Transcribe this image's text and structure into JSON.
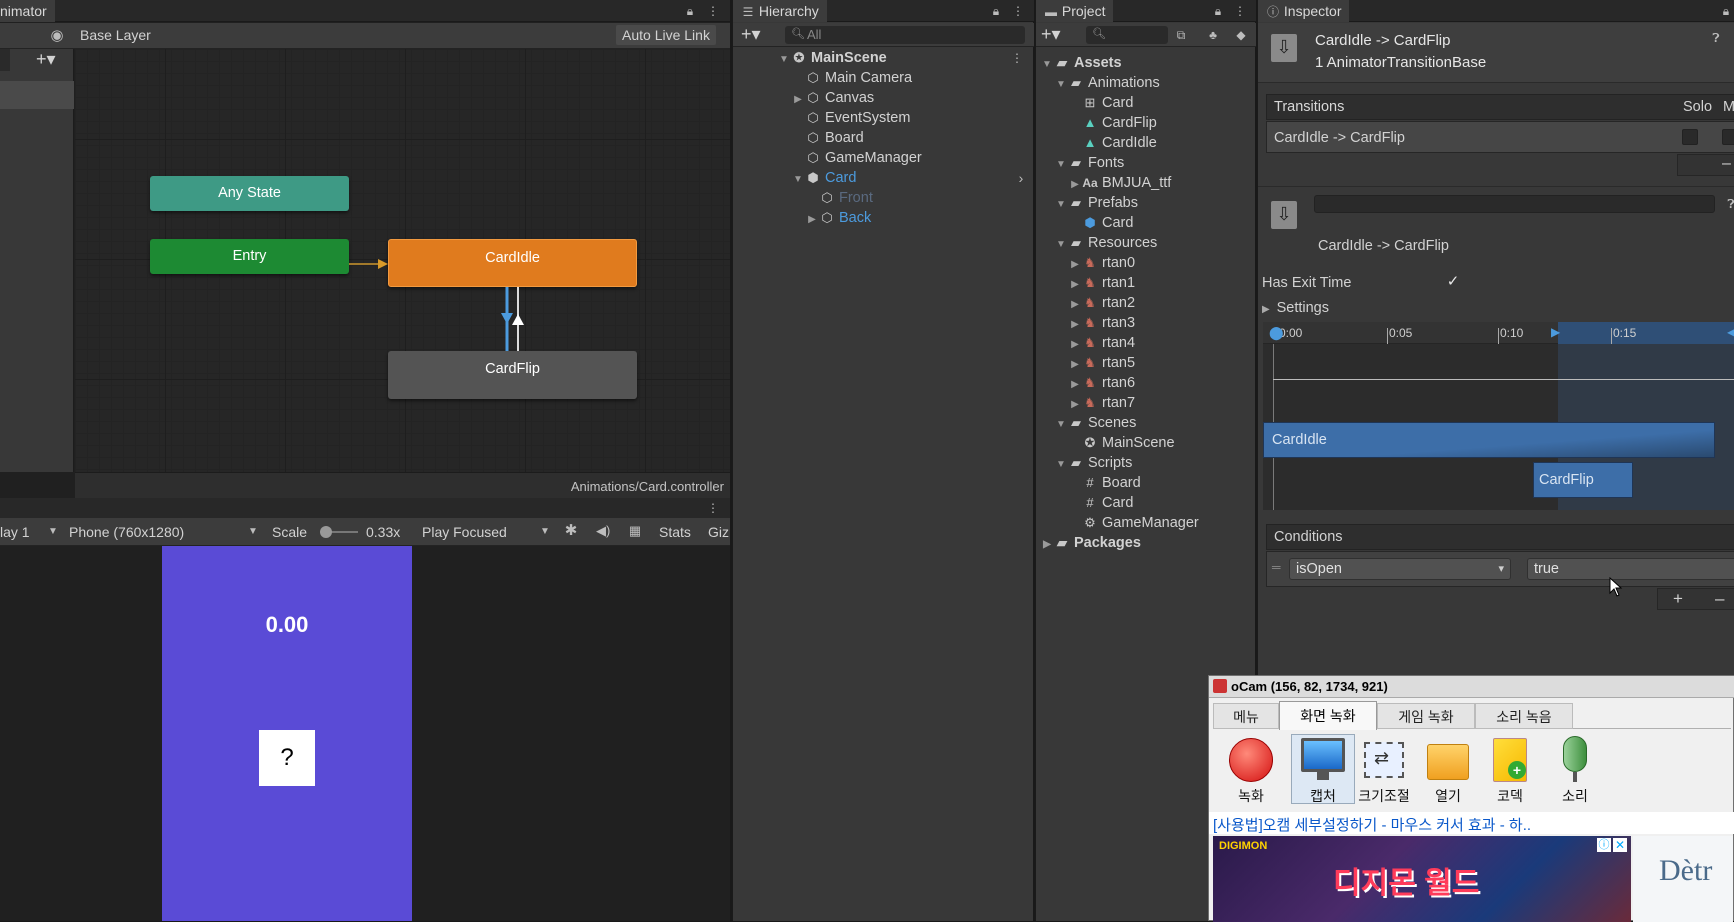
{
  "animator": {
    "tab": "nimator",
    "layer": "Base Layer",
    "auto_live_link": "Auto Live Link",
    "path": "Animations/Card.controller",
    "nodes": {
      "any_state": "Any State",
      "entry": "Entry",
      "card_idle": "CardIdle",
      "card_flip": "CardFlip"
    }
  },
  "game": {
    "display": "lay 1",
    "resolution": "Phone (760x1280)",
    "scale_label": "Scale",
    "scale_value": "0.33x",
    "play_mode": "Play Focused",
    "stats": "Stats",
    "gizmos": "Giz",
    "timer": "0.00",
    "card_text": "?"
  },
  "hierarchy": {
    "tab": "Hierarchy",
    "search_placeholder": "All",
    "items": [
      {
        "label": "MainScene"
      },
      {
        "label": "Main Camera"
      },
      {
        "label": "Canvas"
      },
      {
        "label": "EventSystem"
      },
      {
        "label": "Board"
      },
      {
        "label": "GameManager"
      },
      {
        "label": "Card"
      },
      {
        "label": "Front"
      },
      {
        "label": "Back"
      }
    ]
  },
  "project": {
    "tab": "Project",
    "items": [
      {
        "label": "Assets"
      },
      {
        "label": "Animations"
      },
      {
        "label": "Card"
      },
      {
        "label": "CardFlip"
      },
      {
        "label": "CardIdle"
      },
      {
        "label": "Fonts"
      },
      {
        "label": "BMJUA_ttf"
      },
      {
        "label": "Prefabs"
      },
      {
        "label": "Card"
      },
      {
        "label": "Resources"
      },
      {
        "label": "rtan0"
      },
      {
        "label": "rtan1"
      },
      {
        "label": "rtan2"
      },
      {
        "label": "rtan3"
      },
      {
        "label": "rtan4"
      },
      {
        "label": "rtan5"
      },
      {
        "label": "rtan6"
      },
      {
        "label": "rtan7"
      },
      {
        "label": "Scenes"
      },
      {
        "label": "MainScene"
      },
      {
        "label": "Scripts"
      },
      {
        "label": "Board"
      },
      {
        "label": "Card"
      },
      {
        "label": "GameManager"
      },
      {
        "label": "Packages"
      }
    ]
  },
  "inspector": {
    "tab": "Inspector",
    "title": "CardIdle -> CardFlip",
    "subtitle": "1 AnimatorTransitionBase",
    "transitions_header": "Transitions",
    "solo": "Solo",
    "mute": "Mu",
    "transition_row": "CardIdle -> CardFlip",
    "transition_name": "CardIdle -> CardFlip",
    "has_exit_time": "Has Exit Time",
    "settings": "Settings",
    "timeline": {
      "ticks": [
        "0:00",
        "0:05",
        "0:10",
        "0:15"
      ],
      "state_a": "CardIdle",
      "state_b": "CardFlip"
    },
    "conditions": "Conditions",
    "condition": {
      "param": "isOpen",
      "value": "true"
    }
  },
  "ocam": {
    "title": "oCam (156, 82, 1734, 921)",
    "tabs": [
      "메뉴",
      "화면 녹화",
      "게임 녹화",
      "소리 녹음"
    ],
    "buttons": [
      "녹화",
      "캡처",
      "크기조절",
      "열기",
      "코덱",
      "소리"
    ],
    "link": "[사용법]오캠 세부설정하기 - 마우스 커서 효과 - 하..",
    "ad_text": "디지몬 월드",
    "ad_brand": "DIGIMON",
    "ad_right": "Dètr"
  },
  "colors": {
    "accent": "#4c9bde",
    "card_idle": "#e07b1e",
    "entry": "#1d8a33",
    "any_state": "#3e9a85",
    "game_bg": "#5a4bd6"
  }
}
